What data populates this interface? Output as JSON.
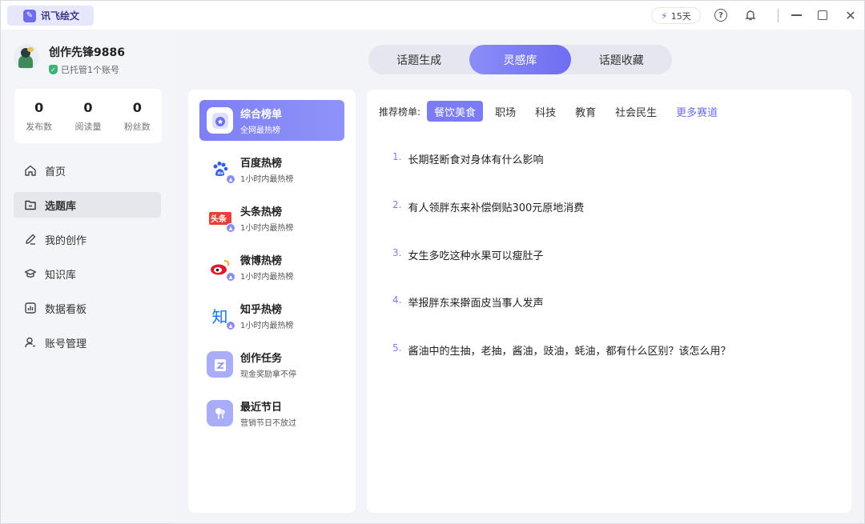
{
  "app": {
    "name": "讯飞绘文"
  },
  "titlebar": {
    "days": "15天"
  },
  "profile": {
    "name": "创作先锋9886",
    "managed": "已托管1个账号"
  },
  "stats": [
    {
      "value": "0",
      "label": "发布数"
    },
    {
      "value": "0",
      "label": "阅读量"
    },
    {
      "value": "0",
      "label": "粉丝数"
    }
  ],
  "nav": [
    {
      "label": "首页",
      "icon": "home-icon"
    },
    {
      "label": "选题库",
      "icon": "folder-icon"
    },
    {
      "label": "我的创作",
      "icon": "pen-icon"
    },
    {
      "label": "知识库",
      "icon": "graduation-cap-icon"
    },
    {
      "label": "数据看板",
      "icon": "chart-icon"
    },
    {
      "label": "账号管理",
      "icon": "user-icon"
    }
  ],
  "tabs": [
    {
      "label": "话题生成"
    },
    {
      "label": "灵感库"
    },
    {
      "label": "话题收藏"
    }
  ],
  "sources": [
    {
      "title": "综合榜单",
      "sub": "全网最热榜",
      "icon": "medal-icon"
    },
    {
      "title": "百度热榜",
      "sub": "1小时内最热榜",
      "icon": "baidu-icon"
    },
    {
      "title": "头条热榜",
      "sub": "1小时内最热榜",
      "icon": "toutiao-icon"
    },
    {
      "title": "微博热榜",
      "sub": "1小时内最热榜",
      "icon": "weibo-icon"
    },
    {
      "title": "知乎热榜",
      "sub": "1小时内最热榜",
      "icon": "zhihu-icon"
    },
    {
      "title": "创作任务",
      "sub": "现金奖励拿不停",
      "icon": "task-icon"
    },
    {
      "title": "最近节日",
      "sub": "营销节日不放过",
      "icon": "festival-icon"
    }
  ],
  "filter": {
    "label": "推荐榜单:",
    "chips": [
      "餐饮美食",
      "职场",
      "科技",
      "教育",
      "社会民生"
    ],
    "more": "更多赛道"
  },
  "topics": [
    {
      "num": "1.",
      "text": "长期轻断食对身体有什么影响"
    },
    {
      "num": "2.",
      "text": "有人领胖东来补偿倒贴300元原地消费"
    },
    {
      "num": "3.",
      "text": "女生多吃这种水果可以瘦肚子"
    },
    {
      "num": "4.",
      "text": "举报胖东来擀面皮当事人发声"
    },
    {
      "num": "5.",
      "text": "酱油中的生抽，老抽，酱油，豉油，蚝油，都有什么区别？该怎么用？"
    }
  ]
}
